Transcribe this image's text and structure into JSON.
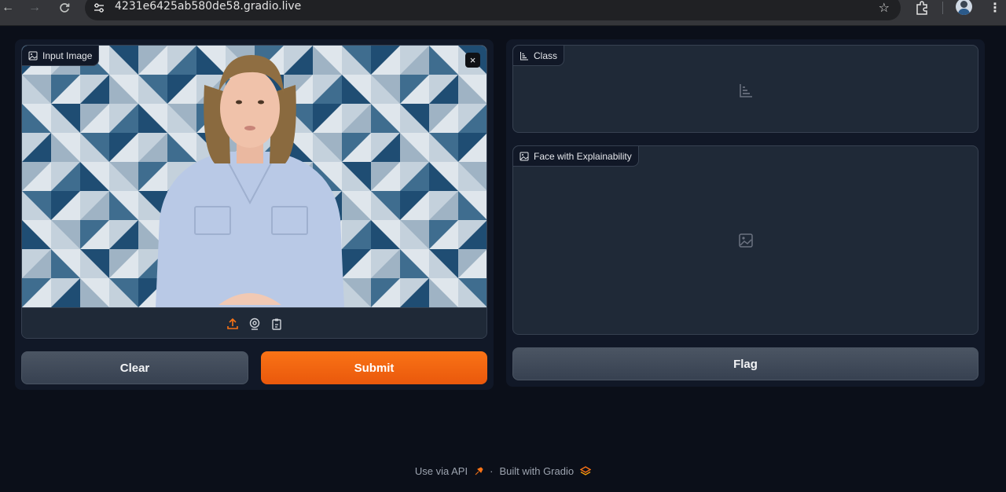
{
  "browser": {
    "url": "4231e6425ab580de58.gradio.live",
    "icons": [
      "back-arrow-icon",
      "forward-arrow-icon",
      "reload-icon",
      "site-settings-icon",
      "bookmark-star-icon",
      "extensions-icon",
      "profile-avatar",
      "menu-dots-icon"
    ]
  },
  "input_panel": {
    "label": "Input Image",
    "close_symbol": "×",
    "sources": [
      "upload-icon",
      "webcam-icon",
      "clipboard-icon"
    ]
  },
  "buttons": {
    "clear": "Clear",
    "submit": "Submit",
    "flag": "Flag"
  },
  "output_panel": {
    "class_label": "Class",
    "face_label": "Face with Explainability"
  },
  "footer": {
    "api": "Use via API",
    "separator": "·",
    "built": "Built with Gradio"
  },
  "colors": {
    "background": "#0b0f19",
    "panel": "#111827",
    "block": "#1f2937",
    "accent": "#f97316"
  }
}
